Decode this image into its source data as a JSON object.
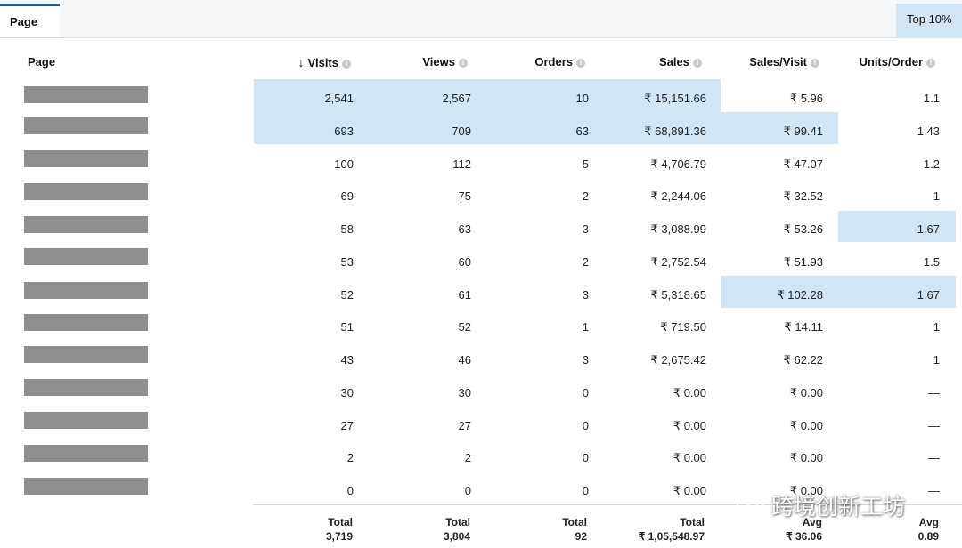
{
  "tabs": {
    "active": "Page",
    "badge": "Top 10%"
  },
  "headers": {
    "page": "Page",
    "visits": "Visits",
    "views": "Views",
    "orders": "Orders",
    "sales": "Sales",
    "sales_visit": "Sales/Visit",
    "units_order": "Units/Order",
    "info_glyph": "i",
    "sort_arrow": "↓"
  },
  "rows": [
    {
      "visits": "2,541",
      "views": "2,567",
      "orders": "10",
      "sales": "₹ 15,151.66",
      "sales_visit": "₹ 5.96",
      "units_order": "1.1"
    },
    {
      "visits": "693",
      "views": "709",
      "orders": "63",
      "sales": "₹ 68,891.36",
      "sales_visit": "₹ 99.41",
      "units_order": "1.43"
    },
    {
      "visits": "100",
      "views": "112",
      "orders": "5",
      "sales": "₹ 4,706.79",
      "sales_visit": "₹ 47.07",
      "units_order": "1.2"
    },
    {
      "visits": "69",
      "views": "75",
      "orders": "2",
      "sales": "₹ 2,244.06",
      "sales_visit": "₹ 32.52",
      "units_order": "1"
    },
    {
      "visits": "58",
      "views": "63",
      "orders": "3",
      "sales": "₹ 3,088.99",
      "sales_visit": "₹ 53.26",
      "units_order": "1.67"
    },
    {
      "visits": "53",
      "views": "60",
      "orders": "2",
      "sales": "₹ 2,752.54",
      "sales_visit": "₹ 51.93",
      "units_order": "1.5"
    },
    {
      "visits": "52",
      "views": "61",
      "orders": "3",
      "sales": "₹ 5,318.65",
      "sales_visit": "₹ 102.28",
      "units_order": "1.67"
    },
    {
      "visits": "51",
      "views": "52",
      "orders": "1",
      "sales": "₹ 719.50",
      "sales_visit": "₹ 14.11",
      "units_order": "1"
    },
    {
      "visits": "43",
      "views": "46",
      "orders": "3",
      "sales": "₹ 2,675.42",
      "sales_visit": "₹ 62.22",
      "units_order": "1"
    },
    {
      "visits": "30",
      "views": "30",
      "orders": "0",
      "sales": "₹ 0.00",
      "sales_visit": "₹ 0.00",
      "units_order": "—"
    },
    {
      "visits": "27",
      "views": "27",
      "orders": "0",
      "sales": "₹ 0.00",
      "sales_visit": "₹ 0.00",
      "units_order": "—"
    },
    {
      "visits": "2",
      "views": "2",
      "orders": "0",
      "sales": "₹ 0.00",
      "sales_visit": "₹ 0.00",
      "units_order": "—"
    },
    {
      "visits": "0",
      "views": "0",
      "orders": "0",
      "sales": "₹ 0.00",
      "sales_visit": "₹ 0.00",
      "units_order": "—"
    }
  ],
  "totals": {
    "visits": {
      "label": "Total",
      "value": "3,719"
    },
    "views": {
      "label": "Total",
      "value": "3,804"
    },
    "orders": {
      "label": "Total",
      "value": "92"
    },
    "sales": {
      "label": "Total",
      "value": "₹ 1,05,548.97"
    },
    "sales_visit": {
      "label": "Avg",
      "value": "₹ 36.06"
    },
    "units_order": {
      "label": "Avg",
      "value": "0.89"
    }
  },
  "watermark": "跨境创新工坊",
  "highlight_color": "#d2e5f5",
  "redaction_color": "#8f8f8f"
}
